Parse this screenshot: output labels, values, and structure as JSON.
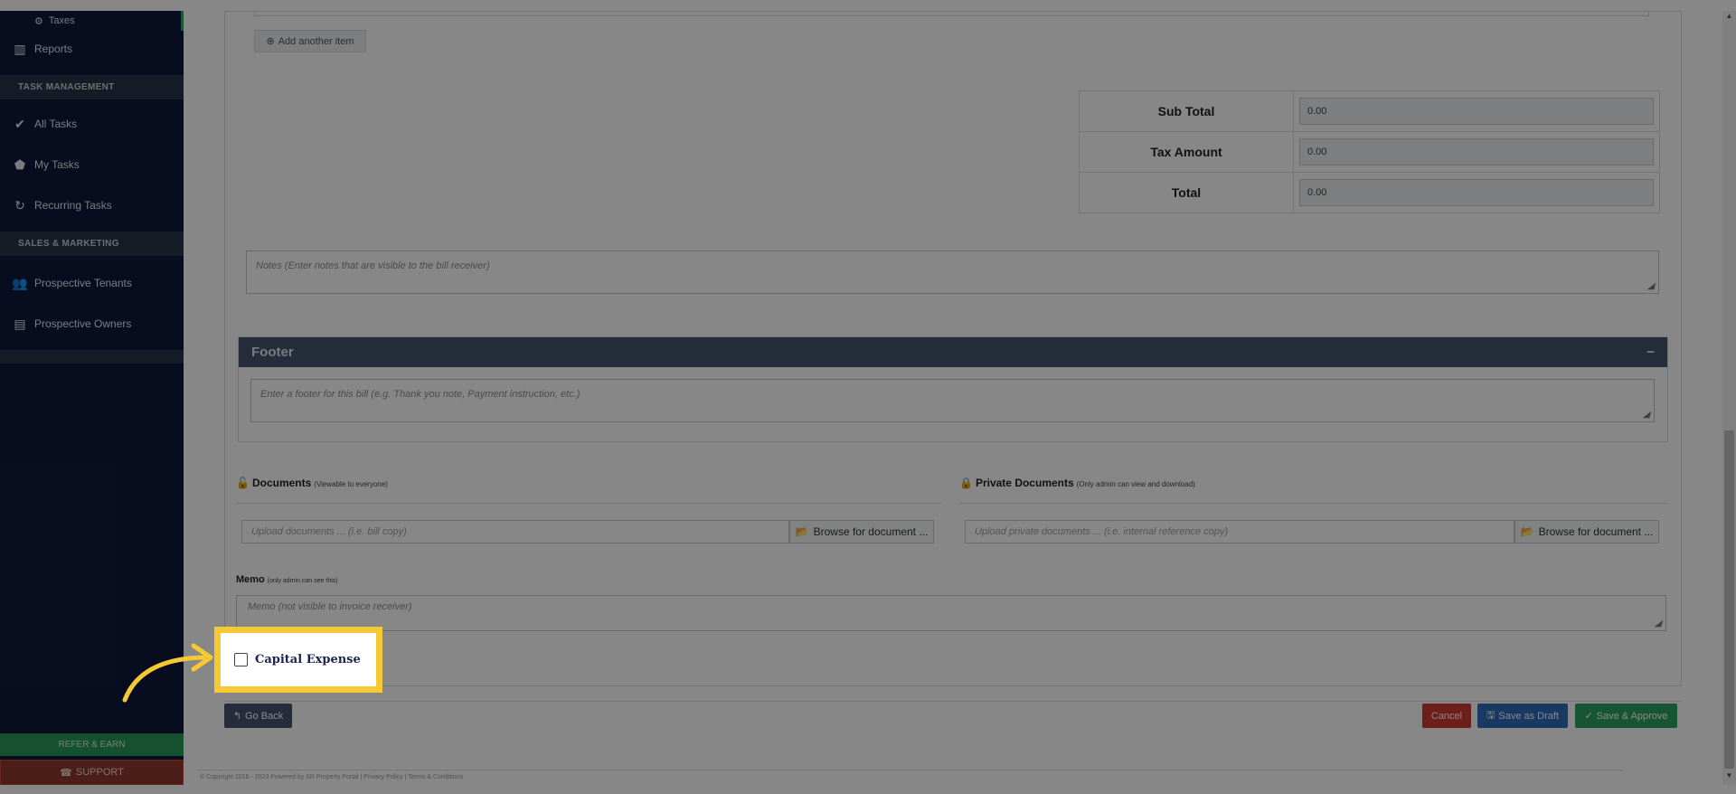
{
  "sidebar": {
    "sub_item": "Taxes",
    "items": [
      {
        "label": "Reports",
        "icon": "bar-chart-icon"
      },
      {
        "label": "All Tasks",
        "icon": "check-icon"
      },
      {
        "label": "My Tasks",
        "icon": "tag-icon"
      },
      {
        "label": "Recurring Tasks",
        "icon": "refresh-icon"
      },
      {
        "label": "Prospective Tenants",
        "icon": "users-icon"
      },
      {
        "label": "Prospective Owners",
        "icon": "id-card-icon"
      }
    ],
    "sections": [
      "TASK MANAGEMENT",
      "SALES & MARKETING"
    ],
    "refer_label": "REFER & EARN",
    "support_label": "SUPPORT"
  },
  "form": {
    "add_item_label": "Add another item",
    "totals": [
      {
        "label": "Sub Total",
        "value": "0.00"
      },
      {
        "label": "Tax Amount",
        "value": "0.00"
      },
      {
        "label": "Total",
        "value": "0.00"
      }
    ],
    "notes_placeholder": "Notes (Enter notes that are visible to the bill receiver)",
    "footer_title": "Footer",
    "footer_collapse": "−",
    "footer_placeholder": "Enter a footer for this bill (e.g. Thank you note, Payment instruction, etc.)",
    "documents": {
      "label": "Documents",
      "hint": "(Viewable to everyone)",
      "placeholder": "Upload documents ... (i.e. bill copy)",
      "browse": "Browse for document ..."
    },
    "private_documents": {
      "label": "Private Documents",
      "hint": "(Only admin can view and download)",
      "placeholder": "Upload private documents ... (i.e. internal reference copy)",
      "browse": "Browse for document ..."
    },
    "memo": {
      "label": "Memo",
      "hint": "(only admin can see this)",
      "placeholder": "Memo (not visible to invoice receiver)"
    },
    "capital_expense_label": "Capital Expense",
    "capital_expense_checked": false
  },
  "actions": {
    "back": "Go Back",
    "cancel": "Cancel",
    "save_draft": "Save as Draft",
    "save_approve": "Save & Approve"
  },
  "footer": {
    "copyright": "© Copyright 2016 - 2023 Powered by SR Property Portal | Privacy Policy | Terms & Conditions"
  },
  "colors": {
    "sidebar_bg": "#0f1a3a",
    "highlight": "#f5c933",
    "cancel": "#cf3b31",
    "draft": "#2f6fba",
    "approve": "#2ea061",
    "footer_header": "#46566f"
  }
}
